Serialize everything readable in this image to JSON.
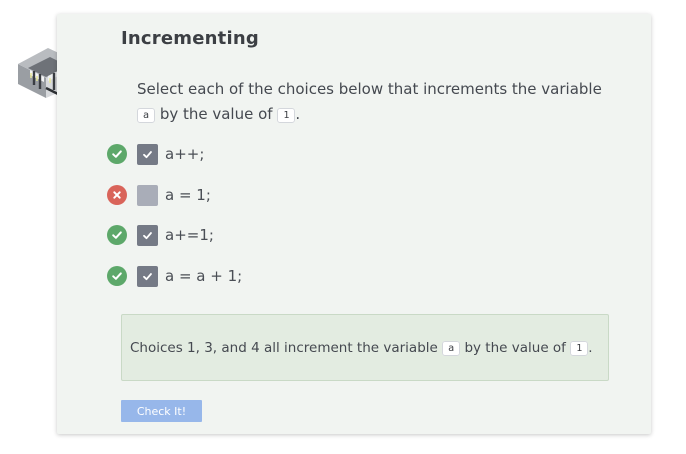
{
  "exercise": {
    "title": "Incrementing",
    "prompt": {
      "before": "Select each of the choices below that increments the variable",
      "var_name": "a",
      "middle": "by the value of",
      "value": "1",
      "after": "."
    }
  },
  "choices": [
    {
      "label": "a++;",
      "checked": true,
      "status": "correct"
    },
    {
      "label": "a = 1;",
      "checked": false,
      "status": "incorrect"
    },
    {
      "label": "a+=1;",
      "checked": true,
      "status": "correct"
    },
    {
      "label": "a = a + 1;",
      "checked": true,
      "status": "correct"
    }
  ],
  "feedback": {
    "before": "Choices 1, 3, and 4 all increment the variable",
    "var_name": "a",
    "middle": "by the value of",
    "value": "1",
    "after": "."
  },
  "check_button": {
    "label": "Check It!"
  },
  "icons": {
    "logo": "isometric-building-logo-icon",
    "correct": "check-circle-icon",
    "incorrect": "x-circle-icon",
    "checkbox_checked": "checkmark-icon"
  },
  "colors": {
    "correct": "#5da86a",
    "incorrect": "#d9645a",
    "button": "#97b7ea",
    "feedback_bg": "#e3ece1"
  }
}
